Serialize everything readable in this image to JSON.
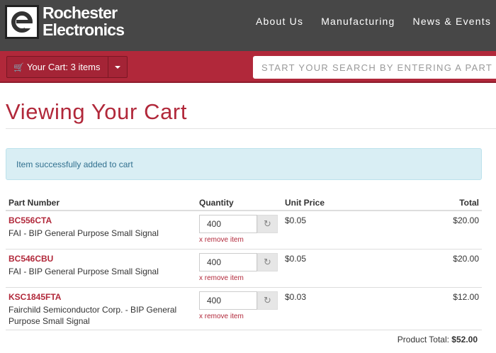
{
  "brand": {
    "line1": "Rochester",
    "line2": "Electronics"
  },
  "nav": {
    "items": [
      "About Us",
      "Manufacturing",
      "News & Events"
    ]
  },
  "cart": {
    "label": "Your Cart: 3 items"
  },
  "search": {
    "placeholder": "START YOUR SEARCH BY ENTERING A PART NUMBER"
  },
  "page": {
    "title": "Viewing Your Cart",
    "alert": "Item successfully added to cart"
  },
  "table": {
    "headers": {
      "part": "Part Number",
      "quantity": "Quantity",
      "unit_price": "Unit Price",
      "total": "Total"
    },
    "remove_label": "x remove item",
    "rows": [
      {
        "part": "BC556CTA",
        "desc": "FAI - BIP General Purpose Small Signal",
        "qty": "400",
        "unit": "$0.05",
        "total": "$20.00"
      },
      {
        "part": "BC546CBU",
        "desc": "FAI - BIP General Purpose Small Signal",
        "qty": "400",
        "unit": "$0.05",
        "total": "$20.00"
      },
      {
        "part": "KSC1845FTA",
        "desc": "Fairchild Semiconductor Corp. - BIP General Purpose Small Signal",
        "qty": "400",
        "unit": "$0.03",
        "total": "$12.00"
      }
    ]
  },
  "summary": {
    "label": "Product Total:",
    "value": "$52.00"
  },
  "colors": {
    "brand_red": "#b1283a",
    "header_gray": "#474747",
    "alert_bg": "#d9eef4"
  }
}
